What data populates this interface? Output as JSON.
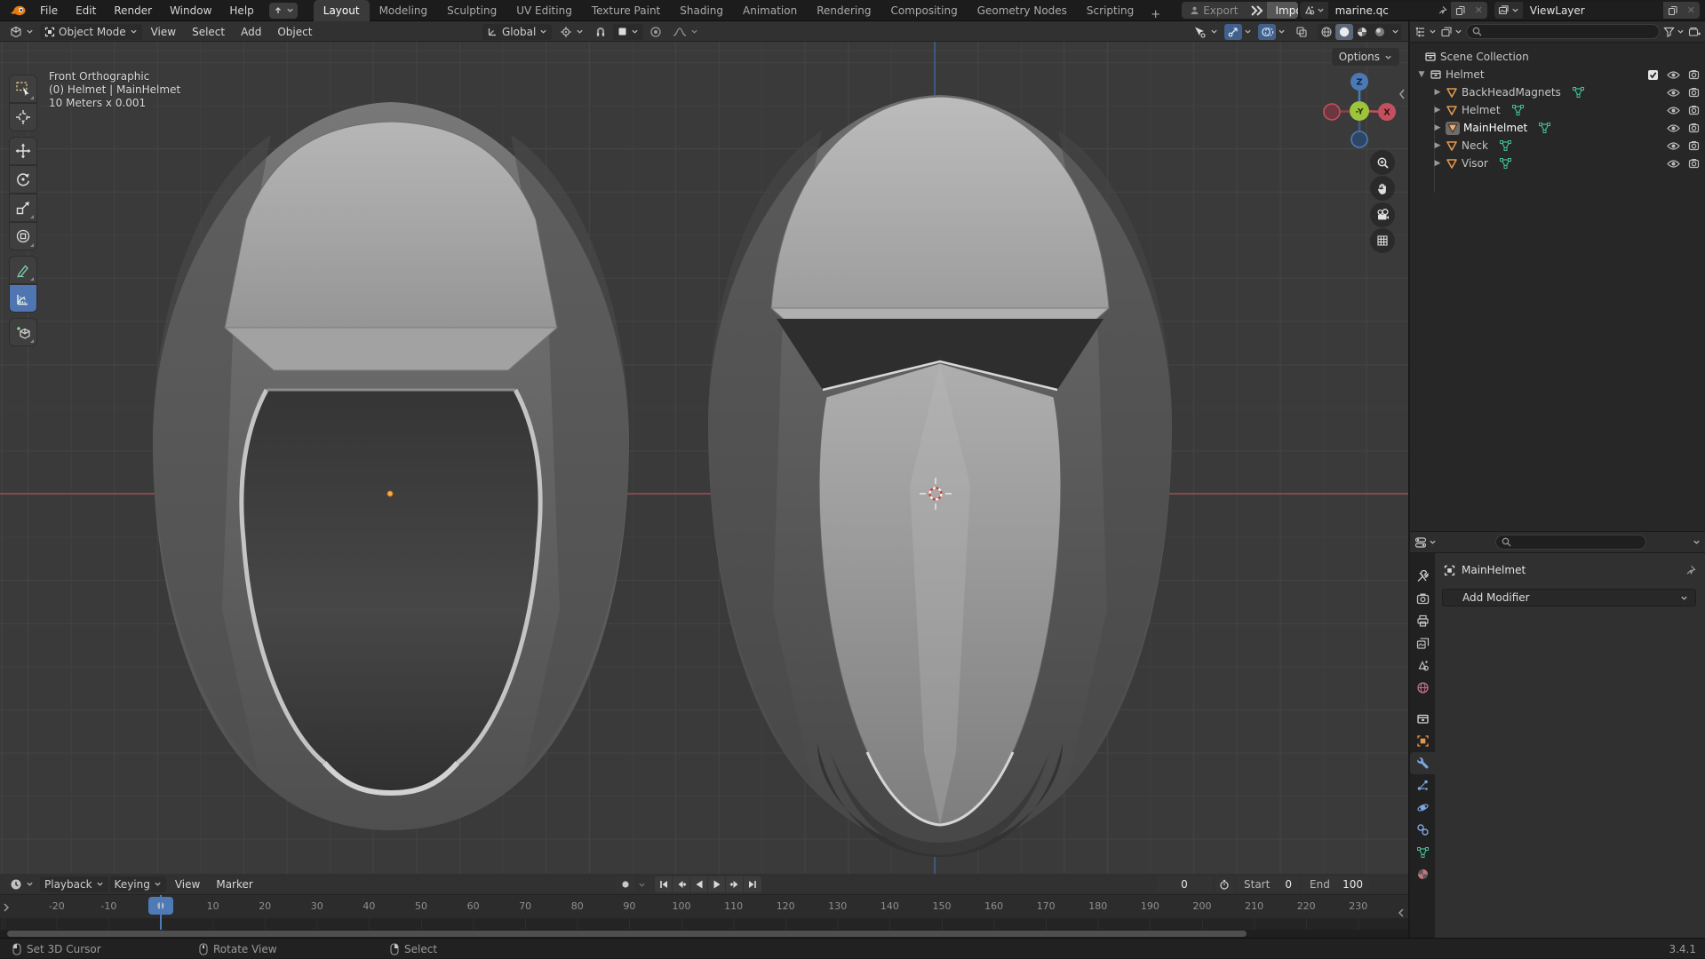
{
  "topbar": {
    "menus": [
      "File",
      "Edit",
      "Render",
      "Window",
      "Help"
    ],
    "workspaces": [
      "Layout",
      "Modeling",
      "Sculpting",
      "UV Editing",
      "Texture Paint",
      "Shading",
      "Animation",
      "Rendering",
      "Compositing",
      "Geometry Nodes",
      "Scripting"
    ],
    "active_workspace": "Layout",
    "new_workspace": "+",
    "export_label": "Export",
    "import_label": "Import",
    "scene_name": "marine.qc",
    "view_layer": "ViewLayer"
  },
  "viewport": {
    "mode": "Object Mode",
    "menus": [
      "View",
      "Select",
      "Add",
      "Object"
    ],
    "orientation": "Global",
    "options": "Options",
    "overlay": {
      "line1": "Front Orthographic",
      "line2": "(0) Helmet | MainHelmet",
      "line3": "10 Meters x 0.001"
    },
    "gizmo": {
      "z": "Z",
      "x": "X",
      "y": "-Y"
    }
  },
  "outliner": {
    "root": "Scene Collection",
    "collection": "Helmet",
    "objects": [
      "BackHeadMagnets",
      "Helmet",
      "MainHelmet",
      "Neck",
      "Visor"
    ],
    "active_object": "MainHelmet"
  },
  "properties": {
    "object_name": "MainHelmet",
    "add_modifier": "Add Modifier"
  },
  "timeline": {
    "playback": "Playback",
    "keying": "Keying",
    "view": "View",
    "marker": "Marker",
    "current_frame": "0",
    "start_label": "Start",
    "start_value": "0",
    "end_label": "End",
    "end_value": "100",
    "frame_start": -20,
    "frame_end": 230,
    "frame_step": 10
  },
  "statusbar": {
    "left": "Set 3D Cursor",
    "middle": "Rotate View",
    "right": "Select",
    "version": "3.4.1"
  },
  "colors": {
    "accent": "#4f7ab8",
    "axis_x": "#9e4a52",
    "axis_z": "#44608f",
    "mesh_icon": "#e0984f",
    "mesh_data_icon": "#43bd8c",
    "gizmo_y": "#9dc43b"
  }
}
